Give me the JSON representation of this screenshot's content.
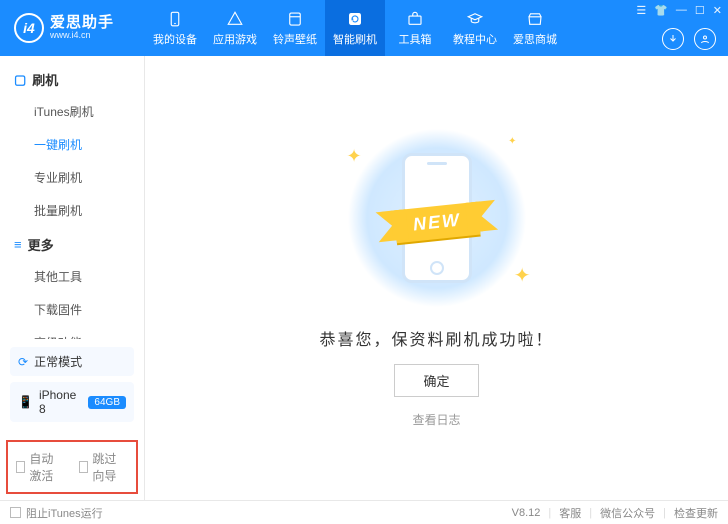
{
  "brand": {
    "logo_letters": "i4",
    "name": "爱思助手",
    "url": "www.i4.cn"
  },
  "nav": {
    "items": [
      {
        "label": "我的设备"
      },
      {
        "label": "应用游戏"
      },
      {
        "label": "铃声壁纸"
      },
      {
        "label": "智能刷机"
      },
      {
        "label": "工具箱"
      },
      {
        "label": "教程中心"
      },
      {
        "label": "爱思商城"
      }
    ]
  },
  "sidebar": {
    "sections": [
      {
        "title": "刷机",
        "items": [
          "iTunes刷机",
          "一键刷机",
          "专业刷机",
          "批量刷机"
        ],
        "active_index": 1
      },
      {
        "title": "更多",
        "items": [
          "其他工具",
          "下载固件",
          "高级功能"
        ]
      }
    ],
    "mode": "正常模式",
    "device": {
      "name": "iPhone 8",
      "storage": "64GB"
    },
    "options": [
      "自动激活",
      "跳过向导"
    ]
  },
  "main": {
    "ribbon": "NEW",
    "success": "恭喜您，保资料刷机成功啦！",
    "ok": "确定",
    "view_log": "查看日志"
  },
  "footer": {
    "block_itunes": "阻止iTunes运行",
    "version": "V8.12",
    "links": [
      "客服",
      "微信公众号",
      "检查更新"
    ]
  }
}
